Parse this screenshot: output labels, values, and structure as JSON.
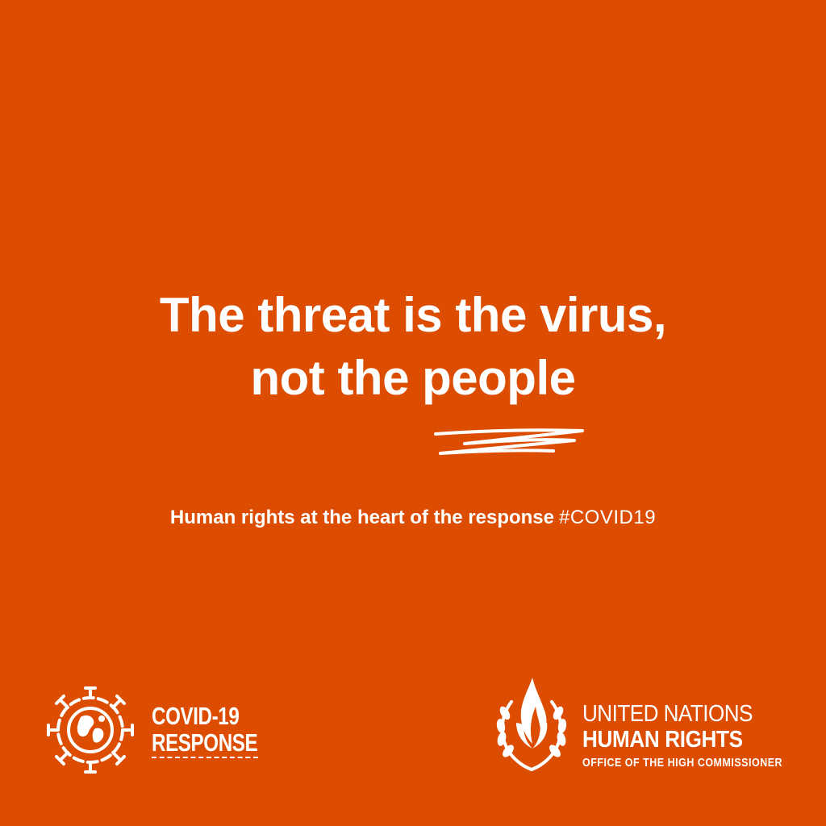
{
  "colors": {
    "background": "#DC4D01",
    "foreground": "#FFFFFF"
  },
  "headline": {
    "line1": "The threat is the virus,",
    "line2": "not the people"
  },
  "tagline": {
    "text": "Human rights at the heart of the response",
    "hashtag": "#COVID19"
  },
  "covid_logo": {
    "icon": "virus-globe-icon",
    "line1": "COVID-19",
    "line2": "RESPONSE"
  },
  "un_logo": {
    "emblem": "flame-laurel-emblem-icon",
    "line1": "UNITED NATIONS",
    "line2": "HUMAN RIGHTS",
    "line3": "OFFICE OF THE HIGH COMMISSIONER"
  }
}
